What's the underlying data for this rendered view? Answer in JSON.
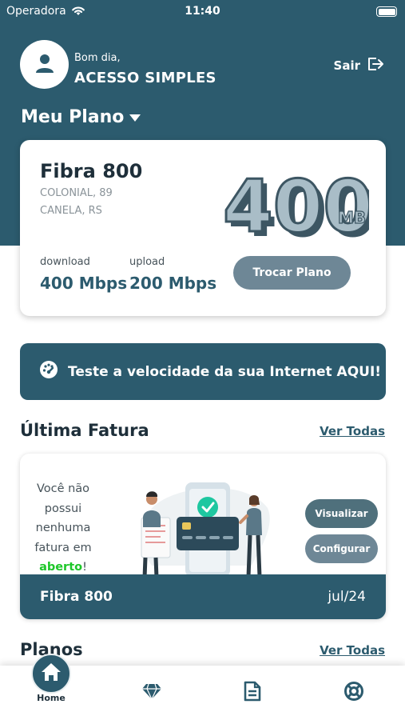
{
  "status_bar": {
    "carrier": "Operadora",
    "time": "11:40"
  },
  "header": {
    "greeting": "Bom dia,",
    "username": "ACESSO SIMPLES",
    "logout_label": "Sair"
  },
  "plan_section": {
    "title": "Meu Plano"
  },
  "plan_card": {
    "name": "Fibra 800",
    "address_line1": "COLONIAL, 89",
    "address_line2": "CANELA, RS",
    "speed_number": "400",
    "speed_unit": "MB",
    "download_label": "download",
    "download_value": "400 Mbps",
    "upload_label": "upload",
    "upload_value": "200 Mbps",
    "change_plan_label": "Trocar Plano"
  },
  "speed_test": {
    "label": "Teste a velocidade da sua Internet AQUI!"
  },
  "invoice_section": {
    "title": "Última Fatura",
    "see_all": "Ver Todas"
  },
  "invoice_card": {
    "msg_part1": "Você não possui nenhuma fatura em ",
    "msg_highlight": "aberto",
    "msg_part2": "!",
    "view_label": "Visualizar",
    "config_label": "Configurar",
    "plan": "Fibra 800",
    "month": "jul/24"
  },
  "plans_section": {
    "title": "Planos",
    "see_all": "Ver Todas"
  },
  "tab_bar": {
    "home_label": "Home"
  },
  "colors": {
    "primary": "#2c5b6e",
    "button_gray": "#6e8796",
    "highlight_green": "#1ec72a"
  },
  "icons": [
    "wifi-icon",
    "battery-icon",
    "user-icon",
    "logout-icon",
    "caret-down-icon",
    "speedometer-icon",
    "home-icon",
    "diamond-icon",
    "document-icon",
    "lifebuoy-icon"
  ]
}
